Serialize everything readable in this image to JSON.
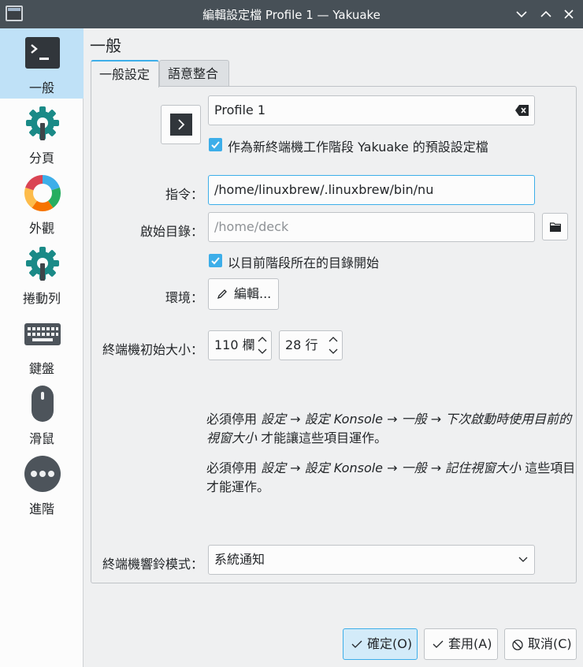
{
  "window": {
    "title": "編輯設定檔 Profile 1 — Yakuake"
  },
  "sidebar": {
    "items": [
      {
        "label": "一般",
        "icon": "terminal-icon"
      },
      {
        "label": "分頁",
        "icon": "gear-icon"
      },
      {
        "label": "外觀",
        "icon": "color-wheel-icon"
      },
      {
        "label": "捲動列",
        "icon": "gear-icon"
      },
      {
        "label": "鍵盤",
        "icon": "keyboard-icon"
      },
      {
        "label": "滑鼠",
        "icon": "mouse-icon"
      },
      {
        "label": "進階",
        "icon": "more-icon"
      }
    ]
  },
  "page": {
    "title": "一般"
  },
  "tabs": [
    "一般設定",
    "語意整合"
  ],
  "general": {
    "profile_name": "Profile 1",
    "default_profile_label": "作為新終端機工作階段 Yakuake 的預設設定檔",
    "command_label": "指令：",
    "command_value": "/home/linuxbrew/.linuxbrew/bin/nu",
    "initial_dir_label": "啟始目錄：",
    "initial_dir_placeholder": "/home/deck",
    "start_current_dir_label": "以目前階段所在的目錄開始",
    "environment_label": "環境：",
    "edit_button": "編輯...",
    "initial_size_label": "終端機初始大小：",
    "columns_value": "110 欄",
    "rows_value": "28 行",
    "note1_a": "必須停用 ",
    "note1_b": "設定 → 設定 Konsole → 一般 → 下次啟動時使用目前的視窗大小",
    "note1_c": " 才能讓這些項目運作。",
    "note2_a": "必須停用 ",
    "note2_b": "設定 → 設定 Konsole → 一般 → 記住視窗大小",
    "note2_c": " 這些項目才能運作。",
    "bell_label": "終端機響鈴模式：",
    "bell_value": "系統通知"
  },
  "buttons": {
    "ok": "確定(O)",
    "apply": "套用(A)",
    "cancel": "取消(C)"
  },
  "colors": {
    "accent": "#3daee9",
    "selected_bg": "#bfe1f7",
    "titlebar": "#475057"
  }
}
